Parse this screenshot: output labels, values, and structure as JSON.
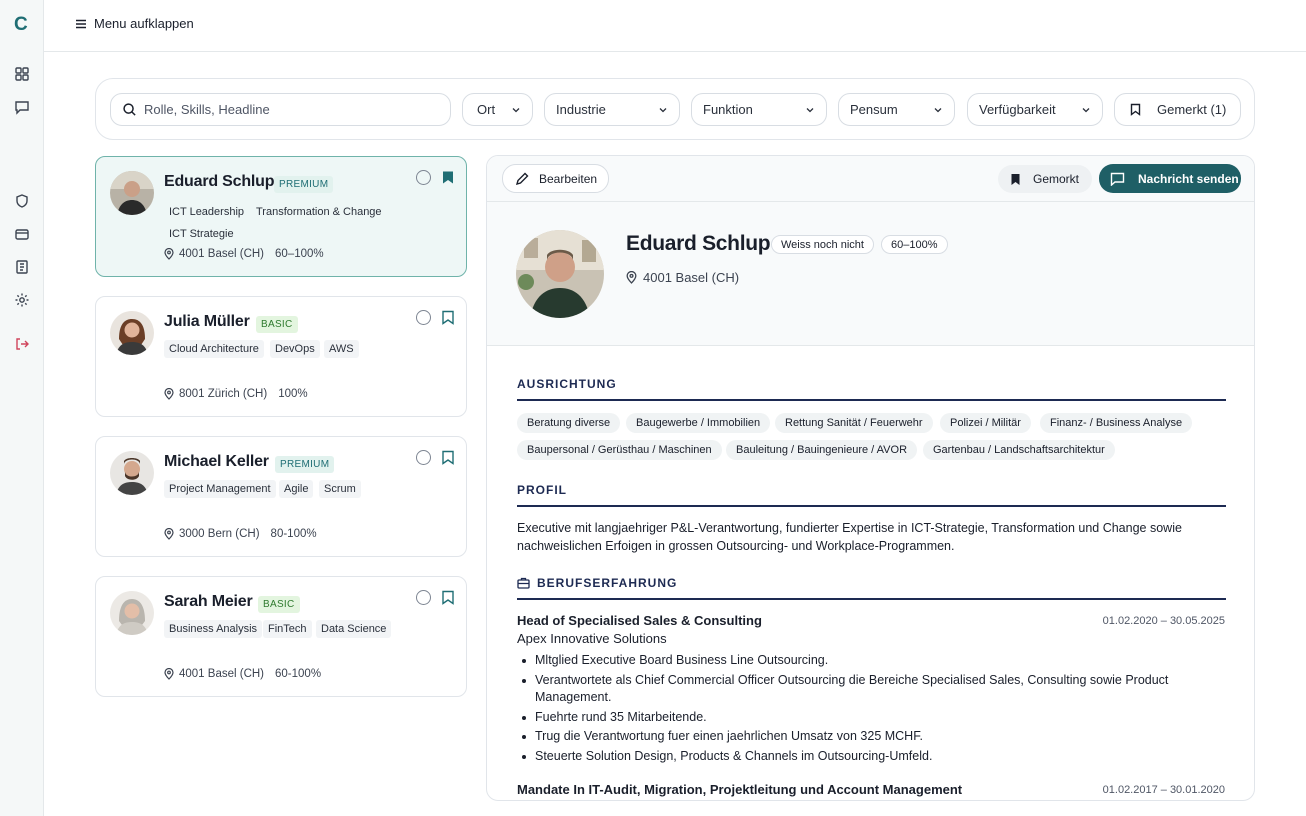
{
  "sidebar": {
    "logo": "C",
    "icons": [
      "dashboard-icon",
      "chat-icon",
      "shield-icon",
      "card-icon",
      "invoice-icon",
      "gear-icon",
      "logout-icon"
    ]
  },
  "topbar": {
    "menu_label": "Menu aufklappen"
  },
  "filters": {
    "search_placeholder": "Rolle, Skills, Headline",
    "dropdowns": [
      "Ort",
      "Industrie",
      "Funktion",
      "Pensum",
      "Verfügbarkeit"
    ],
    "saved": "Gemerkt (1)"
  },
  "candidates": [
    {
      "name": "Eduard Schlup",
      "tier": "PREMIUM",
      "tags": [
        "ICT Leadership",
        "Transformation & Change",
        "ICT Strategie"
      ],
      "location": "4001 Basel (CH)",
      "pensum": "60–100%",
      "bookmarked": true
    },
    {
      "name": "Julia Müller",
      "tier": "BASIC",
      "tags": [
        "Cloud Architecture",
        "DevOps",
        "AWS"
      ],
      "location": "8001 Zürich (CH)",
      "pensum": "100%",
      "bookmarked": false
    },
    {
      "name": "Michael Keller",
      "tier": "PREMIUM",
      "tags": [
        "Project Management",
        "Agile",
        "Scrum"
      ],
      "location": "3000 Bern (CH)",
      "pensum": "80-100%",
      "bookmarked": false
    },
    {
      "name": "Sarah Meier",
      "tier": "BASIC",
      "tags": [
        "Business Analysis",
        "FinTech",
        "Data Science"
      ],
      "location": "4001 Basel (CH)",
      "pensum": "60-100%",
      "bookmarked": false
    }
  ],
  "detail": {
    "edit": "Bearbeiten",
    "saved": "Gemorkt",
    "message": "Nachricht senden",
    "name": "Eduard Schlup",
    "availability": "Weiss noch nicht",
    "pensum": "60–100%",
    "location": "4001 Basel (CH)",
    "ausrichtung_title": "AUSRICHTUNG",
    "ausrichtung": [
      "Beratung diverse",
      "Baugewerbe / Immobilien",
      "Rettung Sanität / Feuerwehr",
      "Polizei / Militär",
      "Finanz- / Business Analyse",
      "Baupersonal / Gerüsthau / Maschinen",
      "Bauleitung / Bauingenieure / AVOR",
      "Gartenbau / Landschaftsarchitektur"
    ],
    "profil_title": "PROFIL",
    "profil": "Executive mit langjaehriger P&L-Verantwortung, fundierter Expertise in ICT-Strategie, Transformation und Change sowie nachweislichen Erfoigen in grossen Outsourcing- und Workplace-Programmen.",
    "experience_title": "BERUFSERFAHRUNG",
    "jobs": [
      {
        "title": "Head of Specialised Sales & Consulting",
        "company": "Apex Innovative Solutions",
        "dates": "01.02.2020 – 30.05.2025",
        "bullets": [
          "Mltglied Executive Board Business Line Outsourcing.",
          "Verantwortete als Chief Commercial Officer Outsourcing die Bereiche Specialised Sales, Consulting sowie Product Management.",
          "Fuehrte rund 35 Mitarbeitende.",
          "Trug die Verantwortung fuer einen jaehrlichen Umsatz von 325 MCHF.",
          "Steuerte Solution Design, Products & Channels im Outsourcing-Umfeld."
        ]
      },
      {
        "title": "Mandate In IT-Audit, Migration, Projektleitung und Account Management",
        "dates": "01.02.2017 – 30.01.2020"
      }
    ]
  },
  "colors": {
    "accent": "#1f5f66",
    "active_card_bg": "#eef7f6",
    "premium_bg": "#e2f2ee",
    "basic_bg": "#e3f5df",
    "heading": "#1d2a52"
  }
}
